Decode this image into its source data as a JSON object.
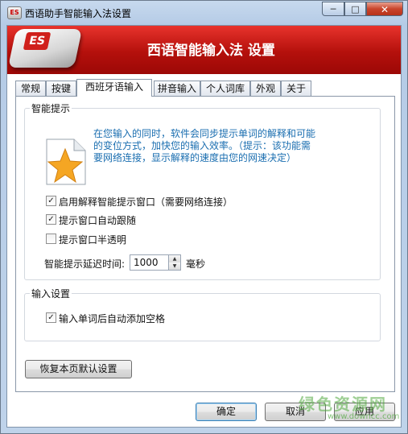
{
  "window": {
    "title": "西语助手智能输入法设置",
    "minimize": "─",
    "maximize": "□",
    "close": "✕"
  },
  "banner": {
    "logo_text": "ES",
    "title": "西语智能输入法 设置"
  },
  "tabs": [
    {
      "label": "常规"
    },
    {
      "label": "按键"
    },
    {
      "label": "西班牙语输入",
      "active": true
    },
    {
      "label": "拼音输入"
    },
    {
      "label": "个人词库"
    },
    {
      "label": "外观"
    },
    {
      "label": "关于"
    }
  ],
  "smart_hint": {
    "group_title": "智能提示",
    "description_line1": "在您输入的同时，软件会同步提示单词的解释和可能",
    "description_line2": "的变位方式，加快您的输入效率。（提示：该功能需",
    "description_line3": "要网络连接，显示解释的速度由您的网速决定）",
    "options": [
      {
        "label": "启用解释智能提示窗口（需要网络连接）",
        "checked": true
      },
      {
        "label": "提示窗口自动跟随",
        "checked": true
      },
      {
        "label": "提示窗口半透明",
        "checked": false
      }
    ],
    "delay_label": "智能提示延迟时间:",
    "delay_value": "1000",
    "delay_unit": "毫秒"
  },
  "input_settings": {
    "group_title": "输入设置",
    "options": [
      {
        "label": "输入单词后自动添加空格",
        "checked": true
      }
    ]
  },
  "buttons": {
    "restore_defaults": "恢复本页默认设置",
    "ok": "确定",
    "cancel": "取消",
    "apply": "应用"
  },
  "watermark": {
    "text": "绿色资源网",
    "url": "www.downcc.com"
  },
  "colors": {
    "banner_red": "#c41a14",
    "hint_text_blue": "#1a6eb0"
  }
}
